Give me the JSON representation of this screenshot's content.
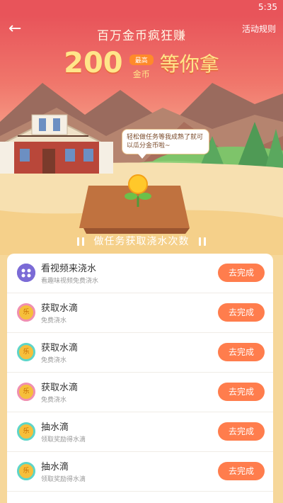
{
  "status_bar": {
    "time": "5:35"
  },
  "header": {
    "back_icon": "arrow-left-icon",
    "title": "百万金币疯狂赚",
    "rules_label": "活动规则"
  },
  "promo": {
    "amount": "200",
    "badge": "最高",
    "unit": "金币",
    "tail": "等你拿"
  },
  "bubble": {
    "text": "轻松做任务等我成熟了就可以瓜分金币啦~"
  },
  "section": {
    "title": "做任务获取浇水次数"
  },
  "tasks": [
    {
      "title": "看视频来浇水",
      "subtitle": "看趣味视频免费浇水",
      "button": "去完成",
      "icon": "video-icon"
    },
    {
      "title": "获取水滴",
      "subtitle": "免费浇水",
      "button": "去完成",
      "icon": "coin-icon"
    },
    {
      "title": "获取水滴",
      "subtitle": "免费浇水",
      "button": "去完成",
      "icon": "coin-icon"
    },
    {
      "title": "获取水滴",
      "subtitle": "免费浇水",
      "button": "去完成",
      "icon": "coin-icon"
    },
    {
      "title": "抽水滴",
      "subtitle": "领取奖励得水滴",
      "button": "去完成",
      "icon": "coin-icon"
    },
    {
      "title": "抽水滴",
      "subtitle": "领取奖励得水滴",
      "button": "去完成",
      "icon": "coin-icon"
    }
  ],
  "coin_glyph": "乐",
  "colors": {
    "header_red": "#e8545a",
    "button_orange": "#ff7d4d",
    "card_white": "#ffffff",
    "accent_yellow": "#ffe68a"
  }
}
